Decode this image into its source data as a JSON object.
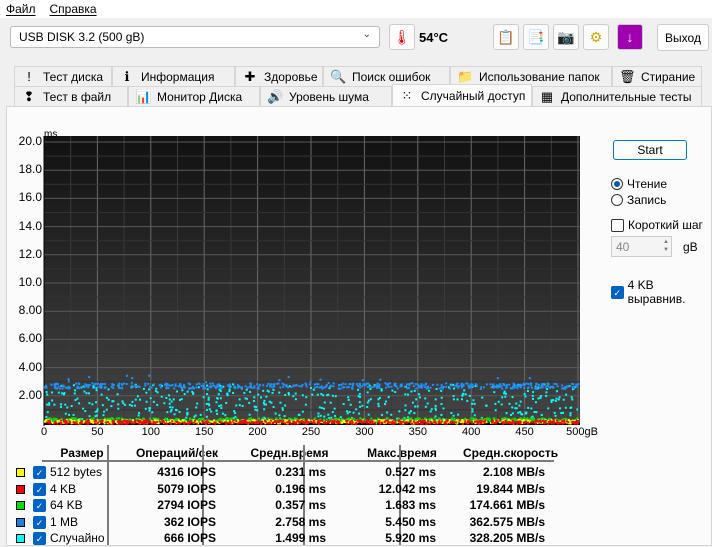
{
  "menu": [
    "Файл",
    "Справка"
  ],
  "drive": "USB DISK 3.2 (500 gB)",
  "temperature": "54°C",
  "toolbar": {
    "exit": "Выход"
  },
  "tabs_row1": [
    {
      "label": "Тест диска",
      "icon": "exclamation-icon"
    },
    {
      "label": "Информация",
      "icon": "info-icon"
    },
    {
      "label": "Здоровье",
      "icon": "health-cross-icon"
    },
    {
      "label": "Поиск ошибок",
      "icon": "magnifier-icon"
    },
    {
      "label": "Использование папок",
      "icon": "folder-icon"
    },
    {
      "label": "Стирание",
      "icon": "trash-icon"
    }
  ],
  "tabs_row2": [
    {
      "label": "Тест в файл",
      "icon": "file-test-icon"
    },
    {
      "label": "Монитор Диска",
      "icon": "monitor-chart-icon"
    },
    {
      "label": "Уровень шума",
      "icon": "speaker-icon"
    },
    {
      "label": "Случайный доступ",
      "icon": "scatter-icon",
      "active": true
    },
    {
      "label": "Дополнительные  тесты",
      "icon": "calculator-icon"
    }
  ],
  "controls": {
    "start": "Start",
    "read": "Чтение",
    "write": "Запись",
    "short_stroke": "Короткий шаг",
    "short_value": "40",
    "unit": "gB",
    "align": "4 KB выравнив.",
    "mode": "read",
    "short_checked": false,
    "align_checked": true
  },
  "chart_data": {
    "type": "scatter",
    "ylabel": "ms",
    "xlabel": "gB",
    "ylim": [
      0,
      20
    ],
    "xlim": [
      0,
      500
    ],
    "yticks": [
      "20.0",
      "18.0",
      "16.0",
      "14.0",
      "12.0",
      "10.0",
      "8.00",
      "6.00",
      "4.00",
      "2.00"
    ],
    "xticks": [
      "0",
      "50",
      "100",
      "150",
      "200",
      "250",
      "300",
      "350",
      "400",
      "450",
      "500gB"
    ],
    "grid": true,
    "series": [
      {
        "name": "512 bytes",
        "color": "#ffff00",
        "avg_ms": 0.231,
        "max_ms": 0.527
      },
      {
        "name": "4 KB",
        "color": "#ff0000",
        "avg_ms": 0.196,
        "max_ms": 12.042
      },
      {
        "name": "64 KB",
        "color": "#00e000",
        "avg_ms": 0.357,
        "max_ms": 1.683
      },
      {
        "name": "1 MB",
        "color": "#1e90ff",
        "avg_ms": 2.758,
        "max_ms": 5.45
      },
      {
        "name": "Случайно",
        "color": "#00ffff",
        "avg_ms": 1.499,
        "max_ms": 5.92
      }
    ]
  },
  "table": {
    "headers": [
      "Размер",
      "Операций/сек",
      "Средн.время",
      "Макс.время",
      "Средн.скорость"
    ],
    "rows": [
      {
        "size": "512 bytes",
        "color": "#ffff00",
        "iops": "4316 IOPS",
        "avg": "0.231 ms",
        "max": "0.527 ms",
        "speed": "2.108 MB/s"
      },
      {
        "size": "4 KB",
        "color": "#ff0000",
        "iops": "5079 IOPS",
        "avg": "0.196 ms",
        "max": "12.042 ms",
        "speed": "19.844 MB/s"
      },
      {
        "size": "64 KB",
        "color": "#00e000",
        "iops": "2794 IOPS",
        "avg": "0.357 ms",
        "max": "1.683 ms",
        "speed": "174.661 MB/s"
      },
      {
        "size": "1 MB",
        "color": "#1e7fe0",
        "iops": "362 IOPS",
        "avg": "2.758 ms",
        "max": "5.450 ms",
        "speed": "362.575 MB/s"
      },
      {
        "size": "Случайно",
        "color": "#00ffff",
        "iops": "666 IOPS",
        "avg": "1.499 ms",
        "max": "5.920 ms",
        "speed": "328.205 MB/s"
      }
    ]
  }
}
